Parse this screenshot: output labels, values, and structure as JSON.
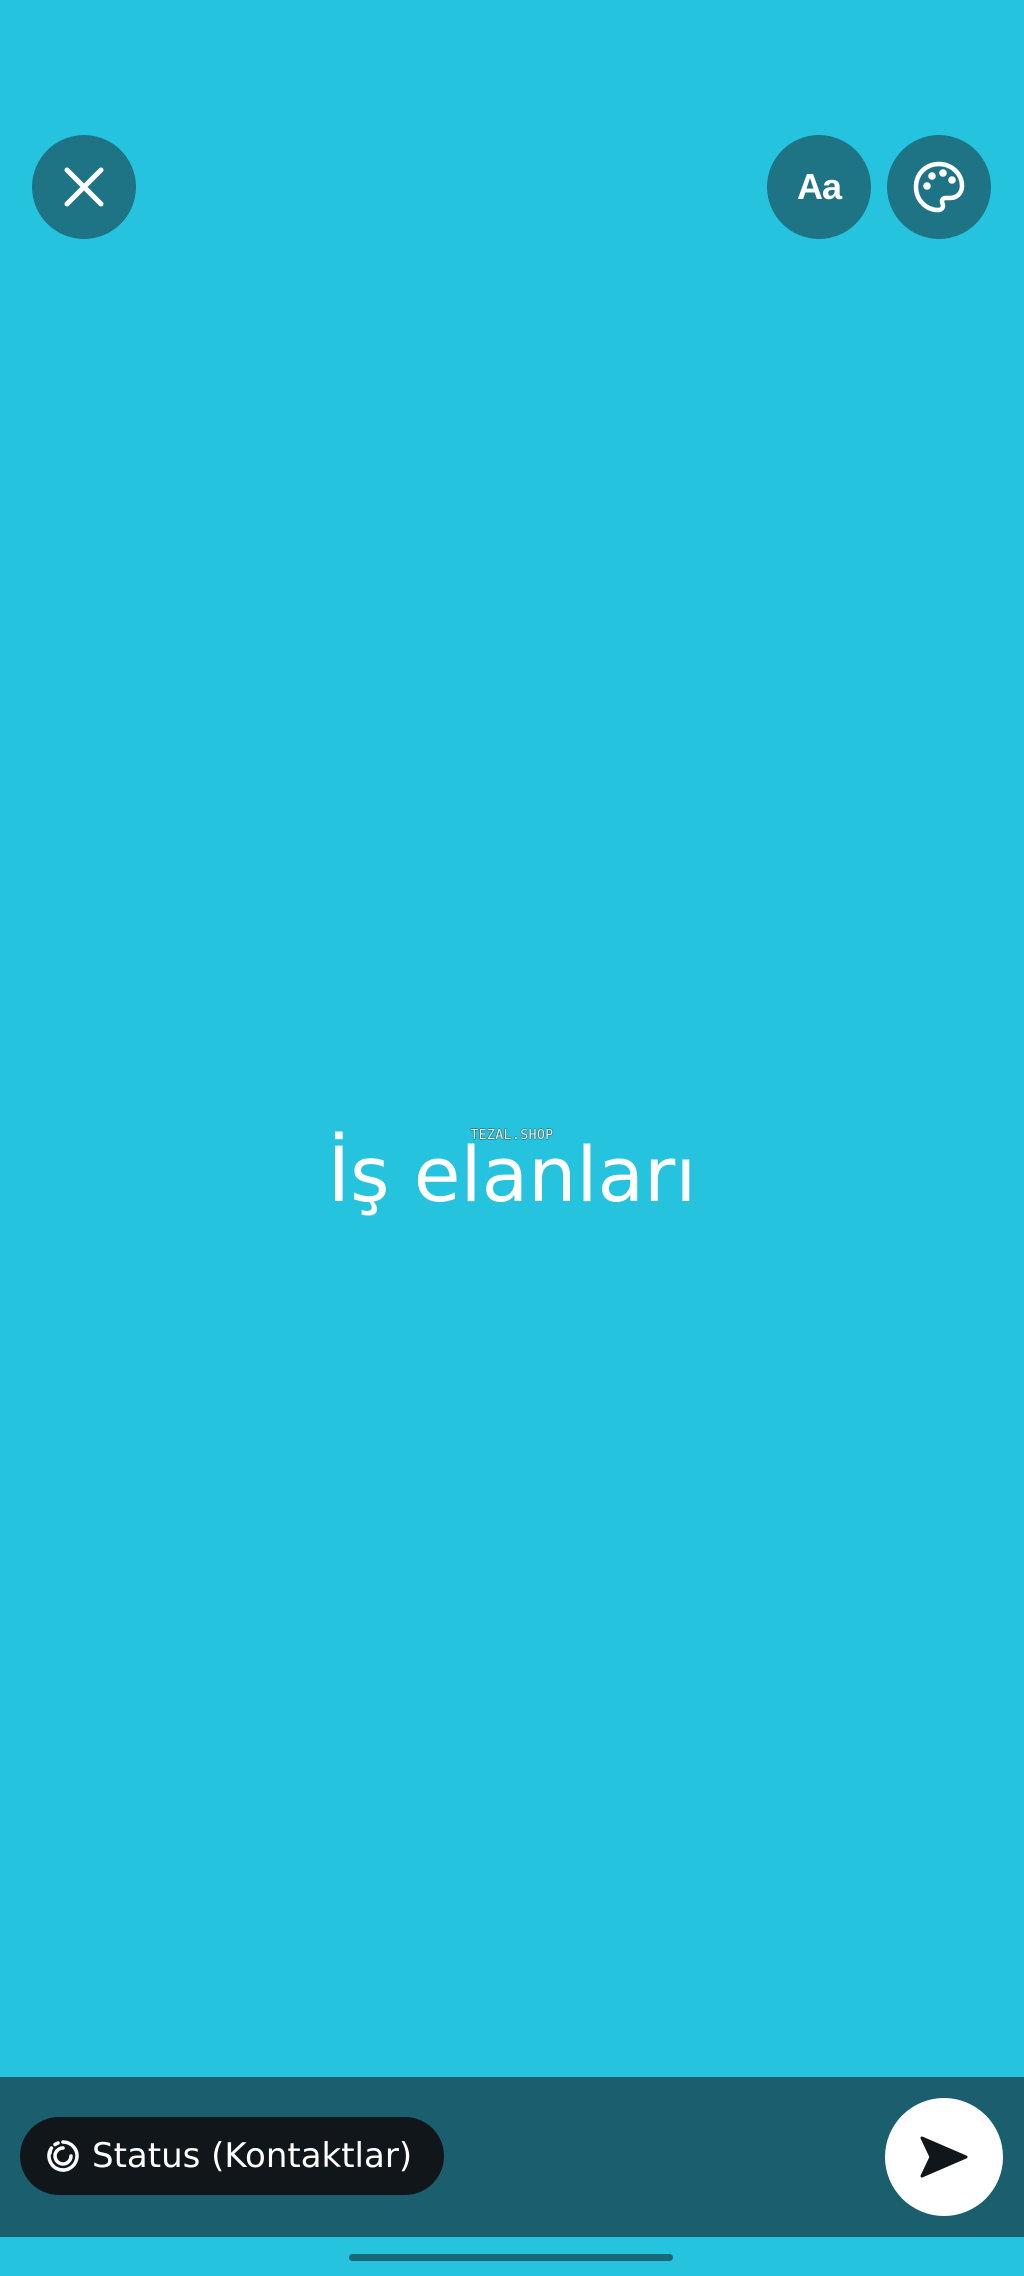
{
  "composer": {
    "background_color": "#25C3DE",
    "status_text": "İş elanları",
    "watermark_text": "TEZAL.SHOP"
  },
  "toolbar": {
    "close_icon": "close-icon",
    "font_button_label": "Aa",
    "palette_icon": "palette-icon"
  },
  "footer": {
    "audience_icon": "status-ring-icon",
    "audience_label": "Status (Kontaktlar)",
    "send_icon": "send-icon"
  },
  "colors": {
    "button_bg": "#1E7385",
    "bar_bg": "#1B5E6E",
    "pill_bg": "#10161A"
  }
}
